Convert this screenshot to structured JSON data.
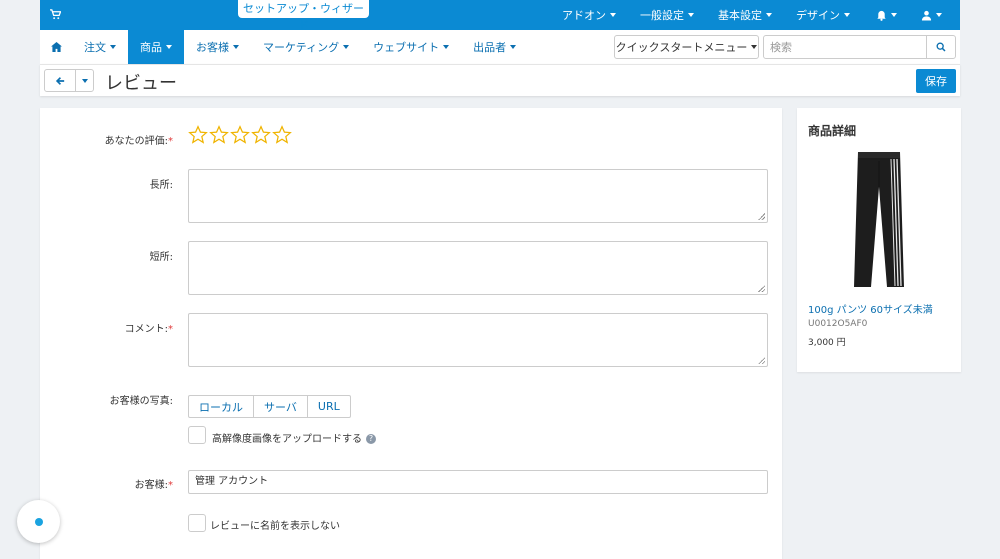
{
  "topbar": {
    "wizard_label": "セットアップ・ウィザード",
    "menu": [
      {
        "label": "アドオン"
      },
      {
        "label": "一般設定"
      },
      {
        "label": "基本設定"
      },
      {
        "label": "デザイン"
      }
    ]
  },
  "mainnav": {
    "items": [
      {
        "label": "注文"
      },
      {
        "label": "商品",
        "active": true
      },
      {
        "label": "お客様"
      },
      {
        "label": "マーケティング"
      },
      {
        "label": "ウェブサイト"
      },
      {
        "label": "出品者"
      }
    ],
    "quickstart_label": "クイックスタートメニュー",
    "search_placeholder": "検索"
  },
  "page": {
    "title": "レビュー",
    "save_label": "保存"
  },
  "form": {
    "rating_label": "あなたの評価:",
    "rating_value": 0,
    "rating_max": 5,
    "pros_label": "長所:",
    "cons_label": "短所:",
    "comment_label": "コメント:",
    "photos_label": "お客様の写真:",
    "photo_sources": [
      "ローカル",
      "サーバ",
      "URL"
    ],
    "hires_label": "高解像度画像をアップロードする",
    "customer_label": "お客様:",
    "customer_value": "管理 アカウント",
    "hide_name_label": "レビューに名前を表示しない",
    "required_mark": "*"
  },
  "product": {
    "heading": "商品詳細",
    "name": "100g パンツ 60サイズ未満",
    "code": "U0012O5AF0",
    "price": "3,000 円"
  },
  "colors": {
    "brand": "#0b8ad3",
    "star": "#f0b400",
    "required": "#e03b3b"
  }
}
